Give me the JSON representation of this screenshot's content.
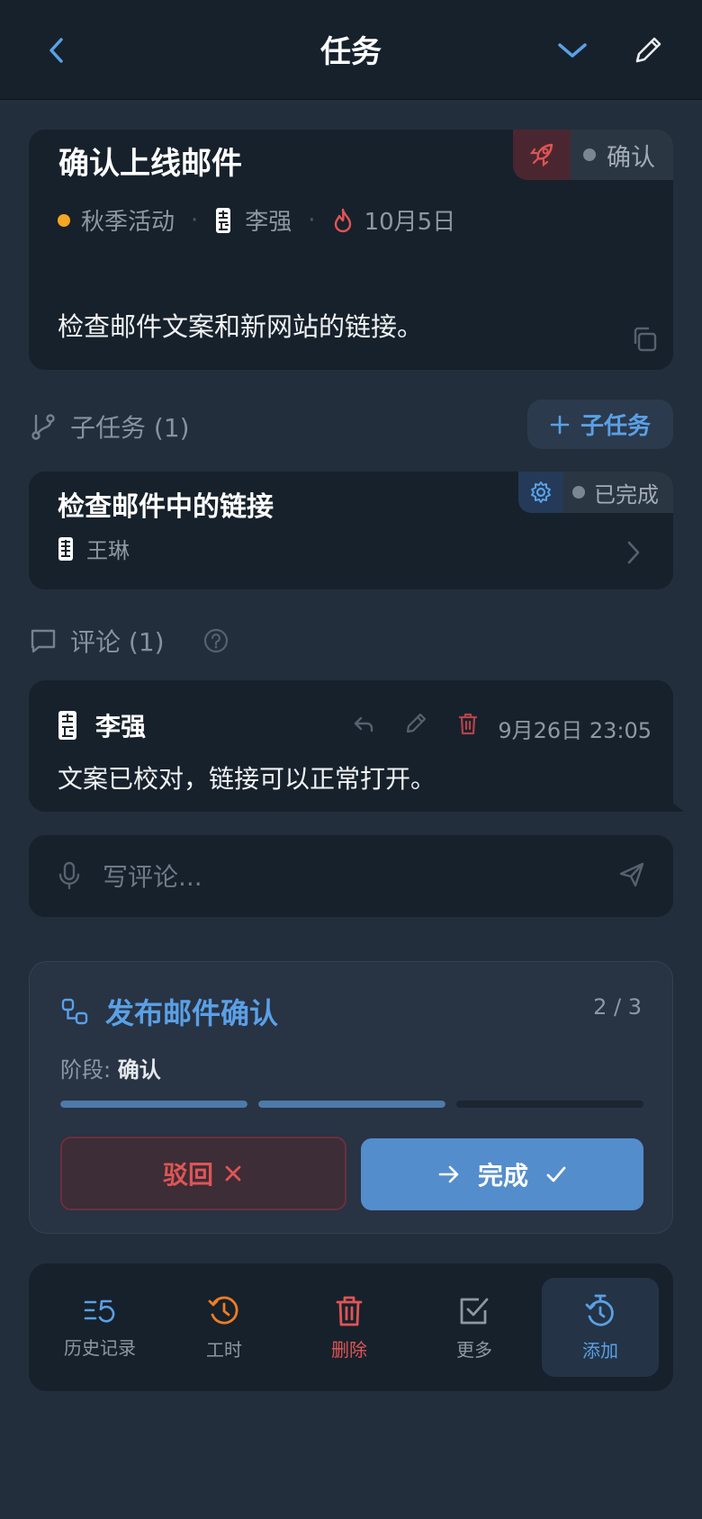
{
  "header": {
    "title": "任务"
  },
  "task": {
    "title": "确认上线邮件",
    "status": "确认",
    "project": "秋季活动",
    "assignee": "李强",
    "due_date": "10月5日",
    "description": "检查邮件文案和新网站的链接。",
    "colors": {
      "project_dot": "#f5a623",
      "due_icon": "#e05555",
      "badge_icon_bg": "#4a2730"
    }
  },
  "subtasks": {
    "heading": "子任务 (1)",
    "add_label": "子任务",
    "items": [
      {
        "title": "检查邮件中的链接",
        "status": "已完成",
        "assignee": "王琳"
      }
    ]
  },
  "comments": {
    "heading": "评论 (1)",
    "items": [
      {
        "author": "李强",
        "time": "9月26日 23:05",
        "text": "文案已校对，链接可以正常打开。"
      }
    ],
    "input_placeholder": "写评论..."
  },
  "workflow": {
    "title": "发布邮件确认",
    "count": "2 / 3",
    "stage_label": "阶段:",
    "stage_value": "确认",
    "progress_steps": [
      1,
      1,
      0
    ],
    "reject_label": "驳回",
    "done_label": "完成"
  },
  "toolbar": {
    "items": [
      {
        "label": "历史记录",
        "icon": "history-list-icon",
        "color": "#8e98a3"
      },
      {
        "label": "工时",
        "icon": "clock-history-icon",
        "color": "#f07c24"
      },
      {
        "label": "删除",
        "icon": "trash-icon",
        "color": "#e05555"
      },
      {
        "label": "更多",
        "icon": "checkbox-icon",
        "color": "#8e98a3"
      },
      {
        "label": "添加",
        "icon": "timer-icon",
        "color": "#5aa0e6"
      }
    ]
  }
}
